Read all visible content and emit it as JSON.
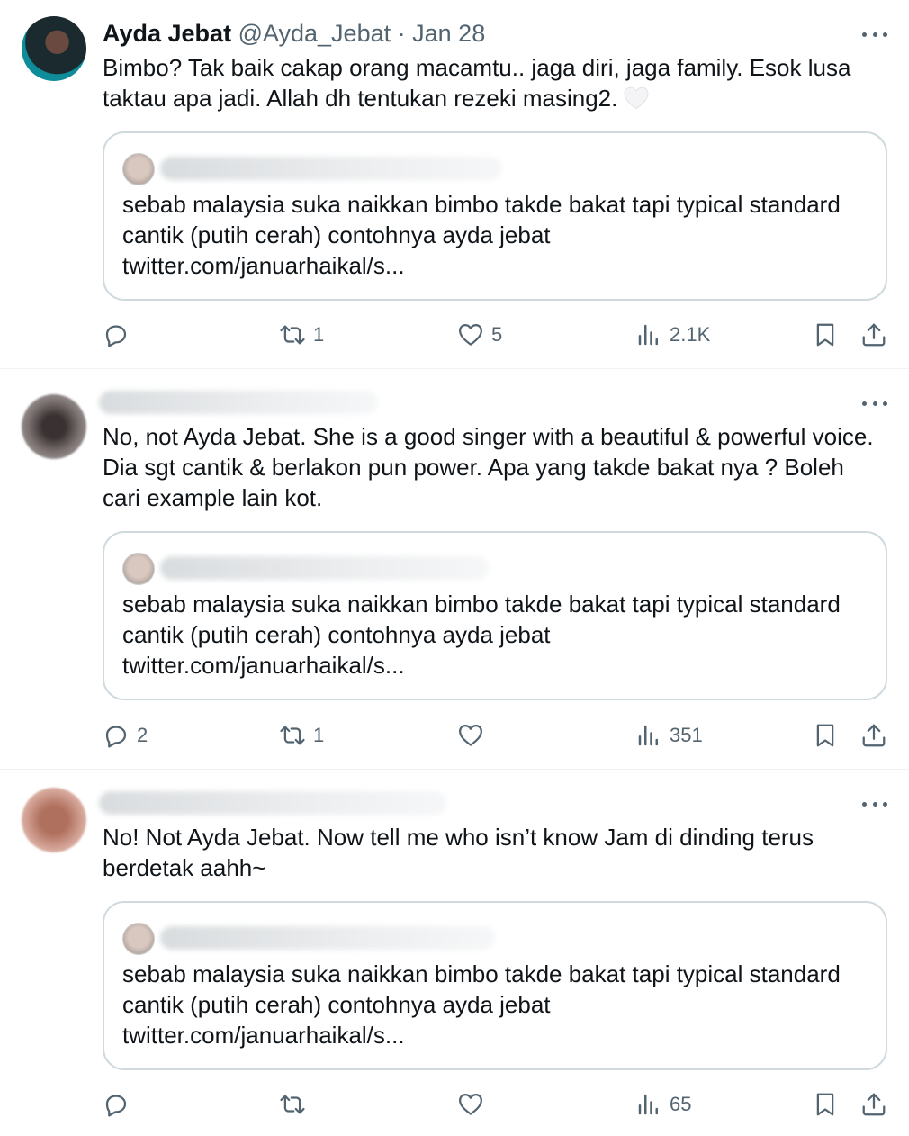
{
  "tweets": [
    {
      "author_name": "Ayda Jebat",
      "author_handle": "@Ayda_Jebat",
      "separator": "·",
      "date": "Jan 28",
      "text": "Bimbo? Tak baik cakap orang macamtu.. jaga diri, jaga family. Esok lusa taktau apa jadi. Allah dh tentukan rezeki masing2.",
      "quote": {
        "text": "sebab malaysia suka naikkan bimbo takde bakat tapi typical standard cantik (putih cerah) contohnya ayda jebat",
        "link": "twitter.com/januarhaikal/s..."
      },
      "stats": {
        "replies": "",
        "retweets": "1",
        "likes": "5",
        "views": "2.1K"
      }
    },
    {
      "text": "No, not Ayda Jebat. She is a good singer with a beautiful & powerful voice. Dia sgt cantik & berlakon pun power. Apa yang takde bakat nya ? Boleh cari example lain kot.",
      "quote": {
        "text": "sebab malaysia suka naikkan bimbo takde bakat tapi typical standard cantik (putih cerah) contohnya ayda jebat",
        "link": "twitter.com/januarhaikal/s..."
      },
      "stats": {
        "replies": "2",
        "retweets": "1",
        "likes": "",
        "views": "351"
      }
    },
    {
      "text": "No! Not Ayda Jebat. Now tell me who isn’t know Jam di dinding terus berdetak aahh~",
      "quote": {
        "text": "sebab malaysia suka naikkan bimbo takde bakat tapi typical standard cantik (putih cerah) contohnya ayda jebat",
        "link": "twitter.com/januarhaikal/s..."
      },
      "stats": {
        "replies": "",
        "retweets": "",
        "likes": "",
        "views": "65"
      }
    }
  ],
  "colors": {
    "text": "#0f1419",
    "muted": "#536471",
    "border": "#cfd9de"
  },
  "icons": [
    "reply-icon",
    "retweet-icon",
    "heart-icon",
    "views-icon",
    "bookmark-icon",
    "share-icon",
    "more-icon"
  ]
}
